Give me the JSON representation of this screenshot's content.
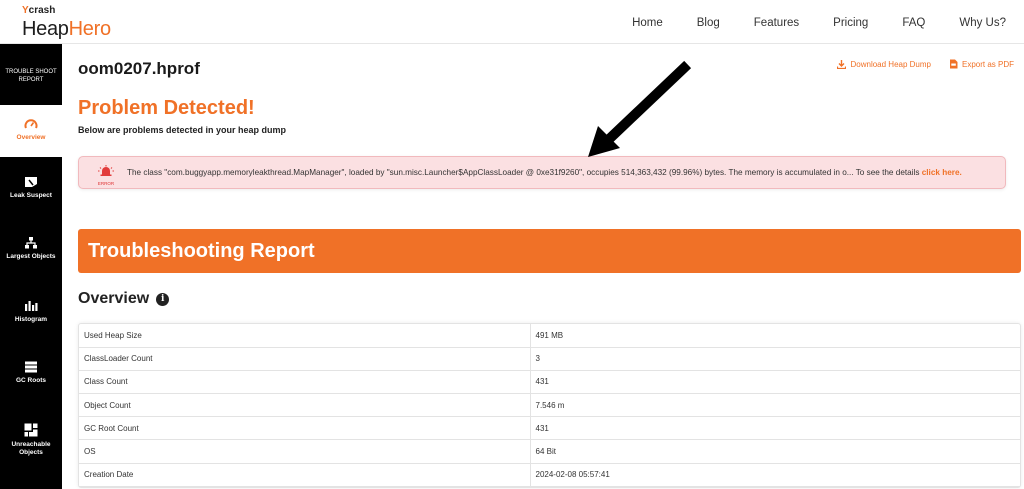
{
  "brand": {
    "small": "crash",
    "small_prefix": "Y",
    "main_a": "Heap",
    "main_b": "Hero"
  },
  "nav": {
    "items": [
      "Home",
      "Blog",
      "Features",
      "Pricing",
      "FAQ",
      "Why Us?"
    ]
  },
  "sidebar": {
    "top_label": "TROUBLE SHOOT REPORT",
    "items": [
      {
        "label": "Overview",
        "icon": "gauge-icon"
      },
      {
        "label": "Leak Suspect",
        "icon": "leak-icon"
      },
      {
        "label": "Largest Objects",
        "icon": "hierarchy-icon"
      },
      {
        "label": "Histogram",
        "icon": "histogram-icon"
      },
      {
        "label": "GC Roots",
        "icon": "stack-icon"
      },
      {
        "label": "Unreachable Objects",
        "icon": "grid-icon"
      }
    ]
  },
  "main": {
    "file_name": "oom0207.hprof",
    "actions": {
      "download": "Download Heap Dump",
      "export": "Export as PDF"
    },
    "problem_title": "Problem Detected!",
    "problem_sub": "Below are problems detected in your heap dump",
    "error": {
      "badge": "ERROR",
      "text": "The class \"com.buggyapp.memoryleakthread.MapManager\", loaded by \"sun.misc.Launcher$AppClassLoader @ 0xe31f9260\", occupies 514,363,432 (99.96%) bytes. The memory is accumulated in o... To see the details ",
      "link": "click here."
    },
    "banner": "Troubleshooting Report",
    "overview_title": "Overview",
    "overview_rows": [
      {
        "key": "Used Heap Size",
        "value": "491 MB"
      },
      {
        "key": "ClassLoader Count",
        "value": "3"
      },
      {
        "key": "Class Count",
        "value": "431"
      },
      {
        "key": "Object Count",
        "value": "7.546 m"
      },
      {
        "key": "GC Root Count",
        "value": "431"
      },
      {
        "key": "OS",
        "value": "64 Bit"
      },
      {
        "key": "Creation Date",
        "value": "2024-02-08 05:57:41"
      }
    ]
  },
  "colors": {
    "accent": "#f07127",
    "sidebar": "#000000",
    "error_bg": "#fbe0e2"
  }
}
